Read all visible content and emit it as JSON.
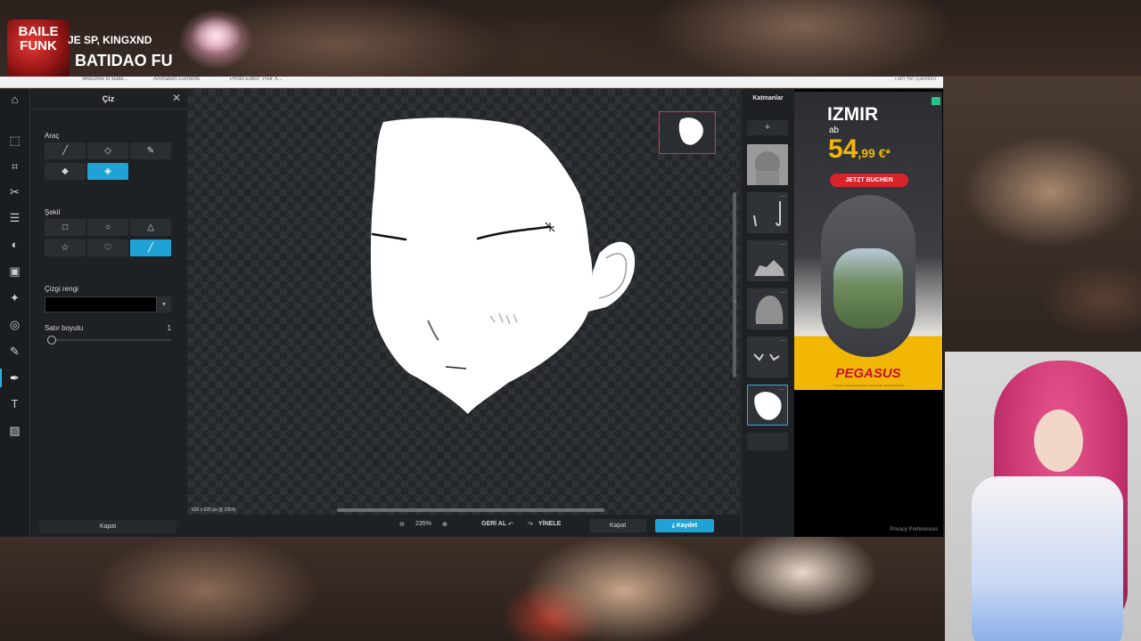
{
  "overlay": {
    "logo_text": "BAILE\nFUNK",
    "line1": "JE SP, KINGXND",
    "line2": "BATIDAO FU"
  },
  "browser": {
    "tabs": [
      "Welcome to Baile...",
      "Animation Contents",
      "Photo Editor: Pixlr X..."
    ],
    "right_text": "Tüm Yer İşaretleri"
  },
  "editor": {
    "panel_title": "Çiz",
    "tools_label": "Araç",
    "shape_label": "Şekil",
    "line_color_label": "Çizgi rengi",
    "line_color": "#000000",
    "line_size_label": "Satır boyutu",
    "line_size_value": "1",
    "line_size_fraction": 0.01,
    "left_close": "Kapat",
    "canvas_status": "620 x 620 px @ 235%",
    "zoom": "235%",
    "undo": "GERİ AL",
    "redo": "YİNELE",
    "close": "Kapat",
    "save": "Kaydet",
    "layers_title": "Katmanlar",
    "accent": "#1fa3d6"
  },
  "ad": {
    "city": "IZMIR",
    "ab": "ab",
    "price_main": "54",
    "price_cents": ",99 €*",
    "cta": "JETZT BUCHEN",
    "brand": "PEGASUS",
    "fine": "* Inklusive Flughafengebühren. Begrenztes Sitzplatzangebot.",
    "privacy": "Privacy Preferences"
  }
}
